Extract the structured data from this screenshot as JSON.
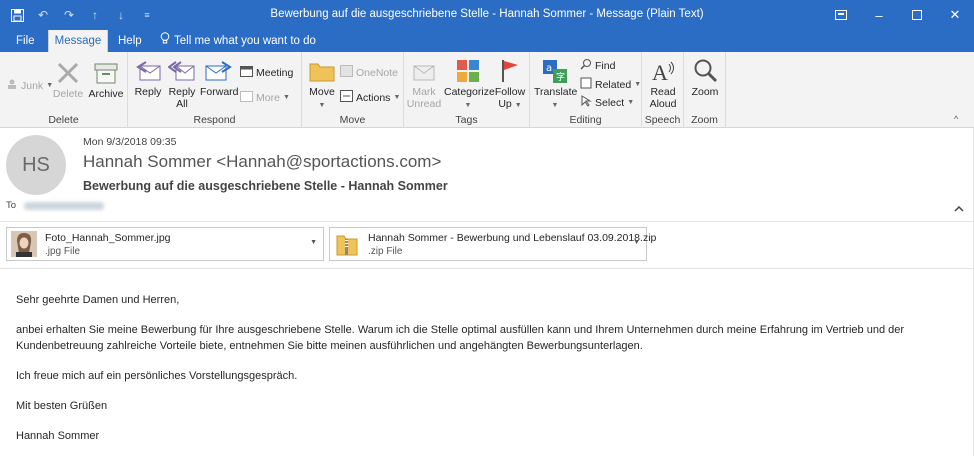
{
  "window": {
    "title": "Bewerbung auf die ausgeschriebene Stelle - Hannah Sommer  -  Message (Plain Text)",
    "qat_icons": [
      "save-icon",
      "undo-icon",
      "redo-icon",
      "up-arrow-icon",
      "down-arrow-icon",
      "customize-icon"
    ],
    "controls": [
      "restore-ribbon-icon",
      "minimize-icon",
      "maximize-icon",
      "close-icon"
    ]
  },
  "tabs": [
    {
      "label": "File"
    },
    {
      "label": "Message"
    },
    {
      "label": "Help"
    }
  ],
  "tell_me": "Tell me what you want to do",
  "ribbon": {
    "delete": {
      "label": "Delete",
      "junk": "Junk",
      "delete_btn": "Delete",
      "archive": "Archive"
    },
    "respond": {
      "label": "Respond",
      "reply": "Reply",
      "reply_all_1": "Reply",
      "reply_all_2": "All",
      "forward": "Forward",
      "meeting": "Meeting",
      "more": "More"
    },
    "move": {
      "label": "Move",
      "move_btn": "Move",
      "onenote": "OneNote",
      "actions": "Actions"
    },
    "tags": {
      "label": "Tags",
      "mark_1": "Mark",
      "mark_2": "Unread",
      "categorize": "Categorize",
      "follow_1": "Follow",
      "follow_2": "Up"
    },
    "editing": {
      "label": "Editing",
      "translate": "Translate",
      "find": "Find",
      "related": "Related",
      "select": "Select"
    },
    "speech": {
      "label": "Speech",
      "read_1": "Read",
      "read_2": "Aloud"
    },
    "zoom": {
      "label": "Zoom",
      "zoom_btn": "Zoom"
    }
  },
  "message": {
    "initials": "HS",
    "date": "Mon 9/3/2018 09:35",
    "sender": "Hannah Sommer <Hannah@sportactions.com>",
    "subject": "Bewerbung auf die ausgeschriebene Stelle - Hannah Sommer",
    "to_label": "To"
  },
  "attachments": [
    {
      "name": "Foto_Hannah_Sommer.jpg",
      "type": ".jpg File"
    },
    {
      "name": "Hannah Sommer - Bewerbung und Lebenslauf 03.09.2018.zip",
      "type": ".zip File"
    }
  ],
  "body": {
    "greeting": "Sehr geehrte Damen und Herren,",
    "para1": "anbei erhalten Sie meine Bewerbung für Ihre ausgeschriebene Stelle. Warum ich die Stelle optimal ausfüllen kann und Ihrem Unternehmen durch meine Erfahrung im Vertrieb und der Kundenbetreuung zahlreiche Vorteile biete, entnehmen Sie bitte meinen ausführlichen und angehängten Bewerbungsunterlagen.",
    "para2": "Ich freue mich auf ein persönliches Vorstellungsgespräch.",
    "closing": "Mit besten Grüßen",
    "signature": "Hannah Sommer"
  },
  "colors": {
    "accent": "#2b6cc4",
    "ribbon_bg": "#f3f3f3"
  }
}
